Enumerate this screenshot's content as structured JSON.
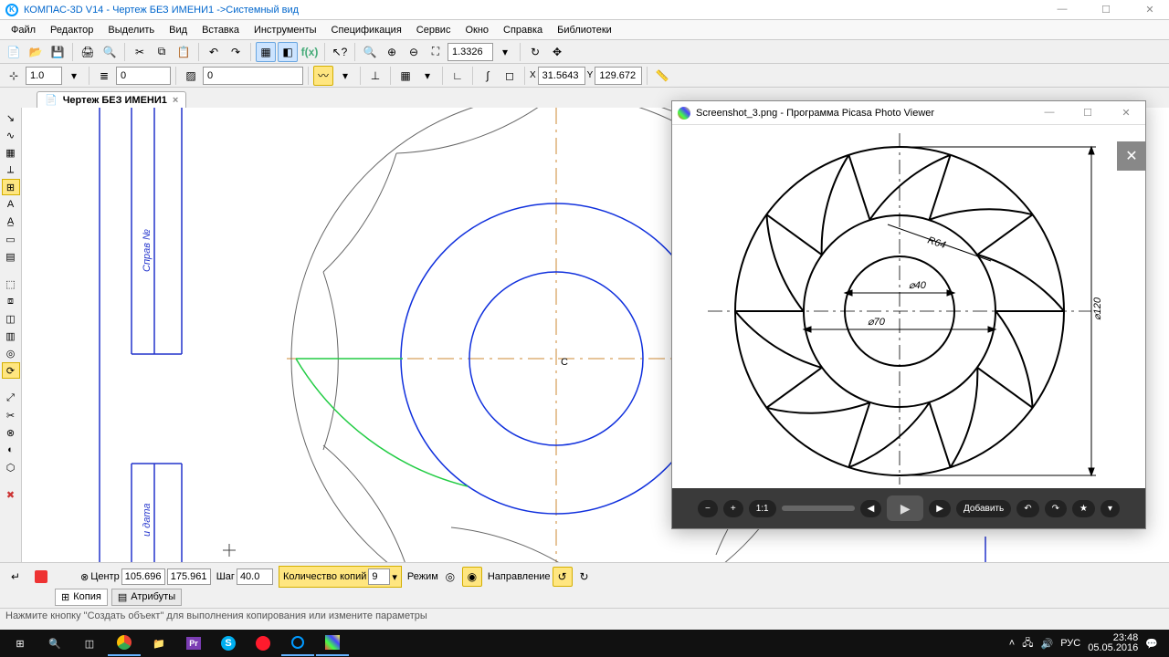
{
  "titlebar": {
    "app": "КОМПАС-3D V14",
    "doc": "Чертеж БЕЗ ИМЕНИ1",
    "suffix": "->Системный вид"
  },
  "menu": [
    "Файл",
    "Редактор",
    "Выделить",
    "Вид",
    "Вставка",
    "Инструменты",
    "Спецификация",
    "Сервис",
    "Окно",
    "Справка",
    "Библиотеки"
  ],
  "toolbars": {
    "zoom": "1.3326",
    "coord_x": "31.5643",
    "coord_y": "129.672",
    "scale": "1.0",
    "layer": "0",
    "style": "0"
  },
  "doctab": {
    "name": "Чертеж БЕЗ ИМЕНИ1"
  },
  "props": {
    "center_label": "Центр",
    "center_x": "105.696",
    "center_y": "175.961",
    "step_label": "Шаг",
    "step": "40.0",
    "copies_label": "Количество копий",
    "copies": "9",
    "mode_label": "Режим",
    "direction_label": "Направление",
    "tab_copy": "Копия",
    "tab_attr": "Атрибуты"
  },
  "statusbar": "Нажмите кнопку \"Создать объект\" для выполнения копирования или измените параметры",
  "picasa": {
    "title": "Screenshot_3.png - Программа Picasa Photo Viewer",
    "add": "Добавить",
    "dims": {
      "r": "R64",
      "d1": "⌀70",
      "d2": "⌀40",
      "d_outer": "⌀120"
    }
  },
  "taskbar": {
    "time": "23:48",
    "date": "05.05.2016",
    "lang": "РУС"
  },
  "chart_data": {
    "type": "diagram",
    "description": "CAD drawing of circular impeller/fan with curved blades",
    "outer_diameter": 120,
    "inner_diameter_1": 70,
    "inner_diameter_2": 40,
    "blade_radius": 64,
    "blade_count_reference": 10,
    "cad_copies_parameter": 9
  }
}
